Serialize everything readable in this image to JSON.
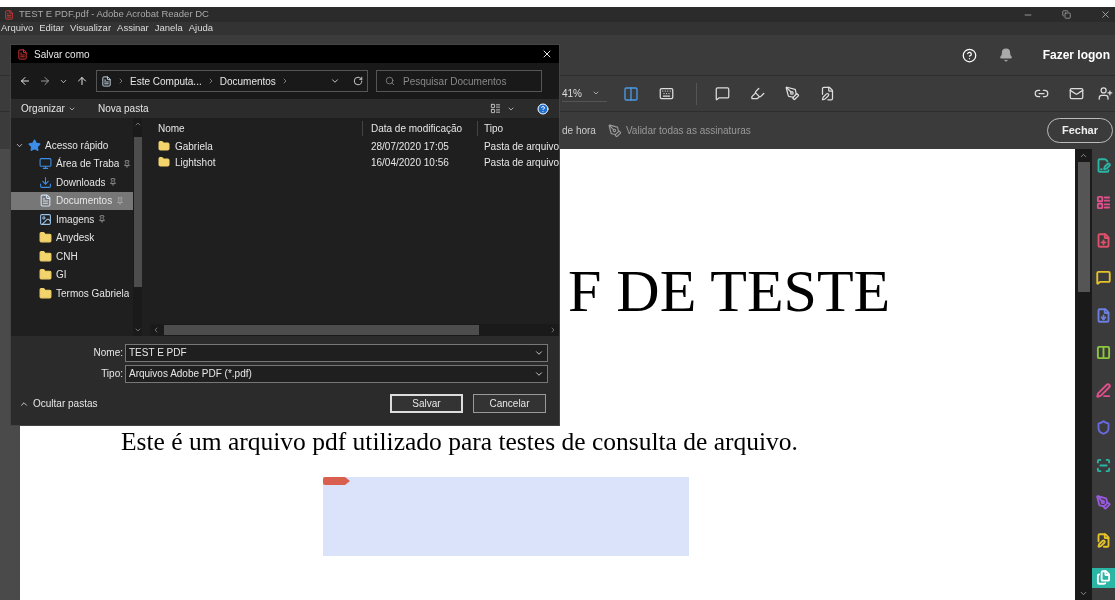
{
  "window": {
    "title": "TEST E PDF.pdf - Adobe Acrobat Reader DC"
  },
  "menu": [
    "Arquivo",
    "Editar",
    "Visualizar",
    "Assinar",
    "Janela",
    "Ajuda"
  ],
  "header": {
    "login": "Fazer logon"
  },
  "toolbar": {
    "zoom": "41%"
  },
  "tool_strip": {
    "partial_label": "de hora",
    "validate": "Validar todas as assinaturas",
    "close": "Fechar"
  },
  "document": {
    "heading": "F DE TESTE",
    "text": "Este é um arquivo pdf utilizado para testes de consulta de arquivo."
  },
  "tools_pane": [
    {
      "color": "#2bb5a5",
      "selected": false
    },
    {
      "color": "#e0508c",
      "selected": false
    },
    {
      "color": "#e0506a",
      "selected": false
    },
    {
      "color": "#e6c229",
      "selected": false
    },
    {
      "color": "#6a7fe0",
      "selected": false
    },
    {
      "color": "#8cc63f",
      "selected": false
    },
    {
      "color": "#e0508c",
      "selected": false
    },
    {
      "color": "#6a6ae0",
      "selected": false
    },
    {
      "color": "#2bb5a5",
      "selected": false
    },
    {
      "color": "#9a5ae0",
      "selected": false
    },
    {
      "color": "#e6c229",
      "selected": false
    },
    {
      "color": "#2bb5a5",
      "selected": true
    }
  ],
  "dialog": {
    "title": "Salvar como",
    "path": [
      "Este Computa...",
      "Documentos"
    ],
    "search": {
      "placeholder": "Pesquisar Documentos"
    },
    "commands": [
      "Organizar",
      "Nova pasta"
    ],
    "nav": [
      {
        "label": "Acesso rápido",
        "kind": "group",
        "expanded": true,
        "pinned": false,
        "selected": false
      },
      {
        "label": "Área de Traba",
        "kind": "desktop",
        "pinned": true,
        "selected": false
      },
      {
        "label": "Downloads",
        "kind": "download",
        "pinned": true,
        "selected": false
      },
      {
        "label": "Documentos",
        "kind": "documents",
        "pinned": true,
        "selected": true
      },
      {
        "label": "Imagens",
        "kind": "pictures",
        "pinned": true,
        "selected": false
      },
      {
        "label": "Anydesk",
        "kind": "folder",
        "pinned": false,
        "selected": false
      },
      {
        "label": "CNH",
        "kind": "folder",
        "pinned": false,
        "selected": false
      },
      {
        "label": "GI",
        "kind": "folder",
        "pinned": false,
        "selected": false
      },
      {
        "label": "Termos Gabriela",
        "kind": "folder",
        "pinned": false,
        "selected": false
      }
    ],
    "columns": [
      "Nome",
      "Data de modificação",
      "Tipo"
    ],
    "rows": [
      {
        "name": "Gabriela",
        "date": "28/07/2020 17:05",
        "type": "Pasta de arquivo"
      },
      {
        "name": "Lightshot",
        "date": "16/04/2020 10:56",
        "type": "Pasta de arquivo"
      }
    ],
    "name_field": {
      "label": "Nome:",
      "value": "TEST E PDF"
    },
    "type_field": {
      "label": "Tipo:",
      "value": "Arquivos Adobe PDF (*.pdf)"
    },
    "hide_folders": "Ocultar pastas",
    "buttons": [
      "Salvar",
      "Cancelar"
    ]
  }
}
